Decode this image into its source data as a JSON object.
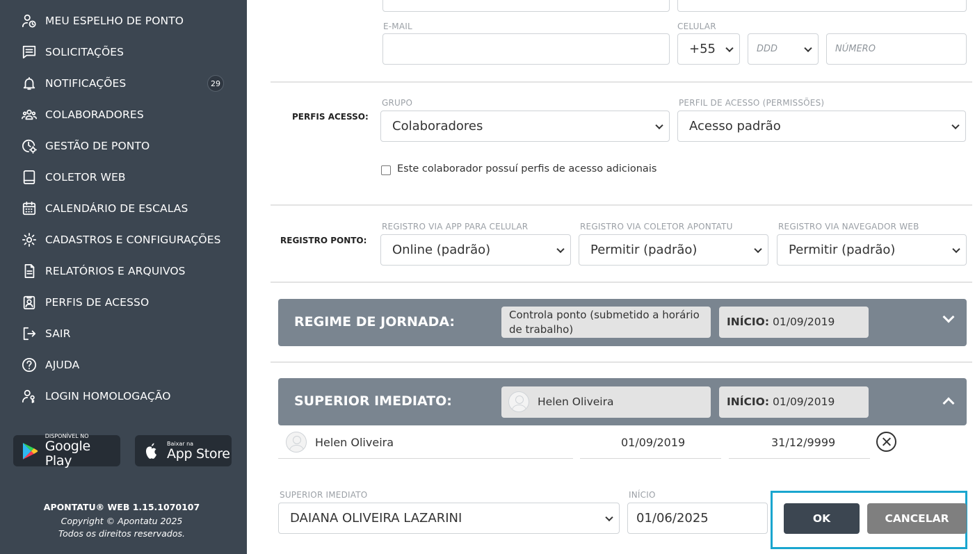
{
  "sidebar": {
    "items": [
      {
        "label": "MEU ESPELHO DE PONTO",
        "icon": "user-clock-icon"
      },
      {
        "label": "SOLICITAÇÕES",
        "icon": "message-list-icon"
      },
      {
        "label": "NOTIFICAÇÕES",
        "icon": "bell-icon"
      },
      {
        "label": "COLABORADORES",
        "icon": "users-icon"
      },
      {
        "label": "GESTÃO DE PONTO",
        "icon": "clock-gear-icon"
      },
      {
        "label": "COLETOR WEB",
        "icon": "tablet-icon"
      },
      {
        "label": "CALENDÁRIO DE ESCALAS",
        "icon": "calendar-icon"
      },
      {
        "label": "CADASTROS E CONFIGURAÇÕES",
        "icon": "gear-icon"
      },
      {
        "label": "RELATÓRIOS E ARQUIVOS",
        "icon": "document-icon"
      },
      {
        "label": "PERFIS DE ACESSO",
        "icon": "id-badge-icon"
      },
      {
        "label": "SAIR",
        "icon": "logout-icon"
      },
      {
        "label": "AJUDA",
        "icon": "help-icon"
      },
      {
        "label": "LOGIN HOMOLOGAÇÃO",
        "icon": "user-key-icon"
      }
    ],
    "notifications_count": "29",
    "google_play": {
      "small": "DISPONÍVEL NO",
      "big": "Google Play"
    },
    "app_store": {
      "small": "Baixar na",
      "big": "App Store"
    },
    "version": "APONTATU® WEB 1.15.1070107",
    "copyright": "Copyright © Apontatu 2025",
    "rights": "Todos os direitos reservados."
  },
  "contact": {
    "email_label": "E-MAIL",
    "email_value": "",
    "celular_label": "CELULAR",
    "country_code": "+55",
    "ddd_placeholder": "DDD",
    "numero_placeholder": "NÚMERO"
  },
  "perfis": {
    "row_label": "PERFIS ACESSO:",
    "grupo_label": "GRUPO",
    "grupo_value": "Colaboradores",
    "perfil_label": "PERFIL DE ACESSO (PERMISSÕES)",
    "perfil_value": "Acesso padrão",
    "checkbox_label": "Este colaborador possuí perfis de acesso adicionais"
  },
  "registro": {
    "row_label": "REGISTRO PONTO:",
    "app_label": "REGISTRO VIA APP PARA CELULAR",
    "app_value": "Online (padrão)",
    "coletor_label": "REGISTRO VIA COLETOR APONTATU",
    "coletor_value": "Permitir (padrão)",
    "navegador_label": "REGISTRO VIA NAVEGADOR WEB",
    "navegador_value": "Permitir (padrão)"
  },
  "regime": {
    "title": "REGIME DE JORNADA:",
    "type": "Controla ponto (submetido a horário de trabalho)",
    "inicio_label": "INÍCIO:",
    "inicio_value": "01/09/2019"
  },
  "superior": {
    "title": "SUPERIOR IMEDIATO:",
    "name": "Helen Oliveira",
    "inicio_label": "INÍCIO:",
    "inicio_value": "01/09/2019",
    "row": {
      "name": "Helen Oliveira",
      "start": "01/09/2019",
      "end": "31/12/9999"
    },
    "form": {
      "superior_label": "SUPERIOR IMEDIATO",
      "superior_value": "DAIANA OLIVEIRA LAZARINI",
      "inicio_label": "INÍCIO",
      "inicio_value": "01/06/2025"
    },
    "ok_label": "OK",
    "cancel_label": "CANCELAR"
  }
}
